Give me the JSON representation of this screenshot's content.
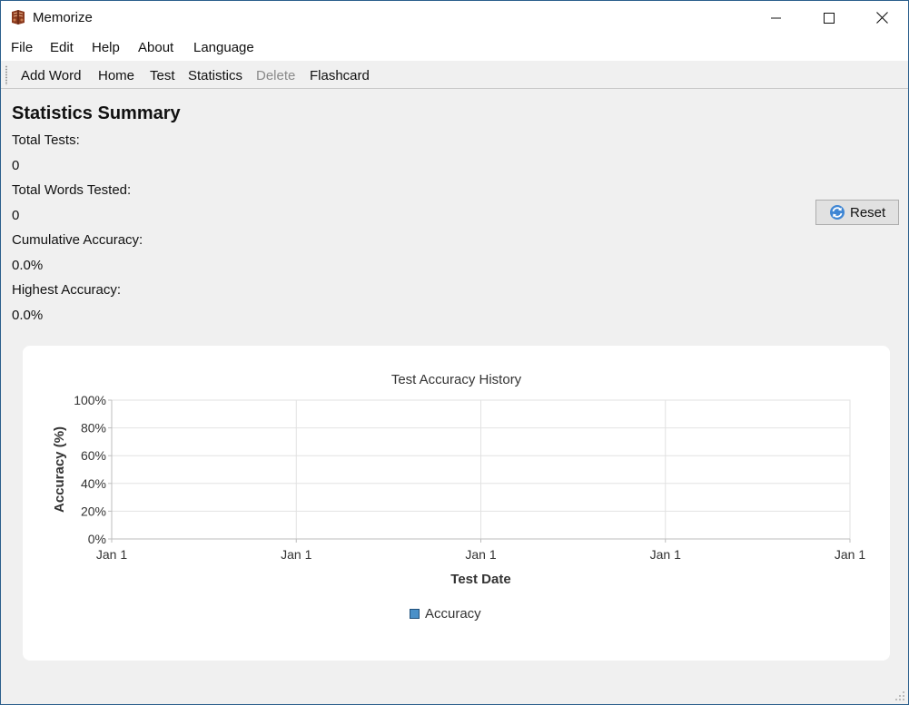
{
  "window": {
    "title": "Memorize"
  },
  "menu": [
    "File",
    "Edit",
    "Help",
    "About",
    "Language"
  ],
  "toolbar": [
    {
      "label": "Add Word",
      "enabled": true
    },
    {
      "label": "Home",
      "enabled": true
    },
    {
      "label": "Test",
      "enabled": true
    },
    {
      "label": "Statistics",
      "enabled": true
    },
    {
      "label": "Delete",
      "enabled": false
    },
    {
      "label": "Flashcard",
      "enabled": true
    }
  ],
  "summary": {
    "title": "Statistics Summary",
    "total_tests_label": "Total Tests:",
    "total_tests_value": "0",
    "total_words_label": "Total Words Tested:",
    "total_words_value": "0",
    "cumulative_label": "Cumulative Accuracy:",
    "cumulative_value": "0.0%",
    "highest_label": "Highest Accuracy:",
    "highest_value": "0.0%",
    "reset_label": "Reset"
  },
  "chart_data": {
    "type": "line",
    "title": "Test Accuracy History",
    "xlabel": "Test Date",
    "ylabel": "Accuracy (%)",
    "y_ticks": [
      "0%",
      "20%",
      "40%",
      "60%",
      "80%",
      "100%"
    ],
    "x_ticks": [
      "Jan 1",
      "Jan 1",
      "Jan 1",
      "Jan 1",
      "Jan 1"
    ],
    "ylim": [
      0,
      100
    ],
    "grid": true,
    "series": [
      {
        "name": "Accuracy",
        "values": [],
        "color": "#4a90c8"
      }
    ],
    "legend": "bottom-center"
  }
}
